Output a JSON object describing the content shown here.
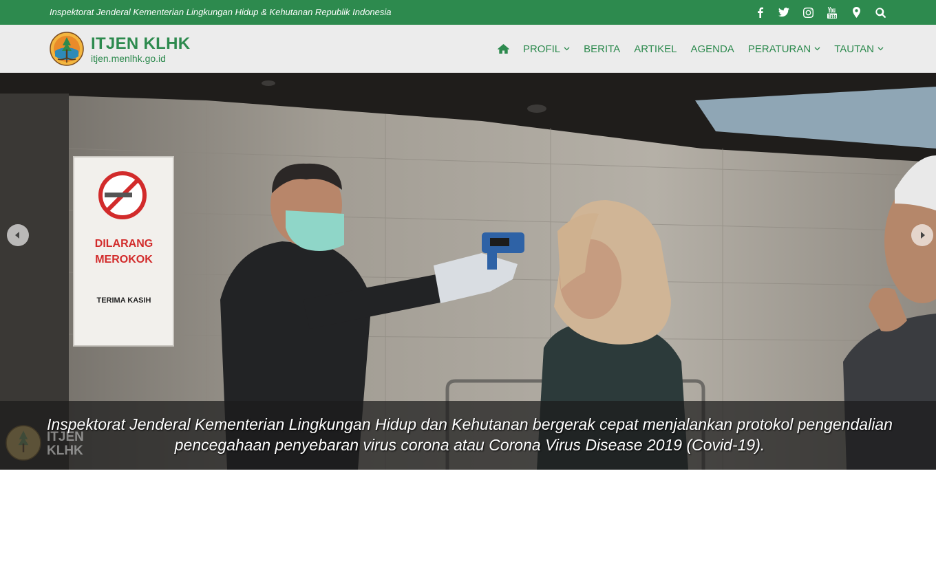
{
  "topbar": {
    "tagline": "Inspektorat Jenderal Kementerian Lingkungan Hidup & Kehutanan Republik Indonesia",
    "icons": [
      "facebook-icon",
      "twitter-icon",
      "instagram-icon",
      "youtube-icon",
      "map-marker-icon",
      "search-icon"
    ]
  },
  "header": {
    "brand_title": "ITJEN KLHK",
    "brand_subtitle": "itjen.menlhk.go.id",
    "nav": {
      "profil": "PROFIL",
      "berita": "BERITA",
      "artikel": "ARTIKEL",
      "agenda": "AGENDA",
      "peraturan": "PERATURAN",
      "tautan": "TAUTAN"
    }
  },
  "slider": {
    "caption": "Inspektorat Jenderal Kementerian Lingkungan Hidup dan Kehutanan bergerak cepat menjalankan protokol pengendalian pencegahaan penyebaran virus corona atau Corona Virus Disease 2019 (Covid-19).",
    "sign_line1": "DILARANG",
    "sign_line2": "MEROKOK",
    "sign_line3": "TERIMA KASIH",
    "watermark_line1": "ITJEN",
    "watermark_line2": "KLHK"
  },
  "colors": {
    "brand_green": "#2d8a4e",
    "header_bg": "#ececec",
    "caption_band": "#1c1c1c"
  }
}
